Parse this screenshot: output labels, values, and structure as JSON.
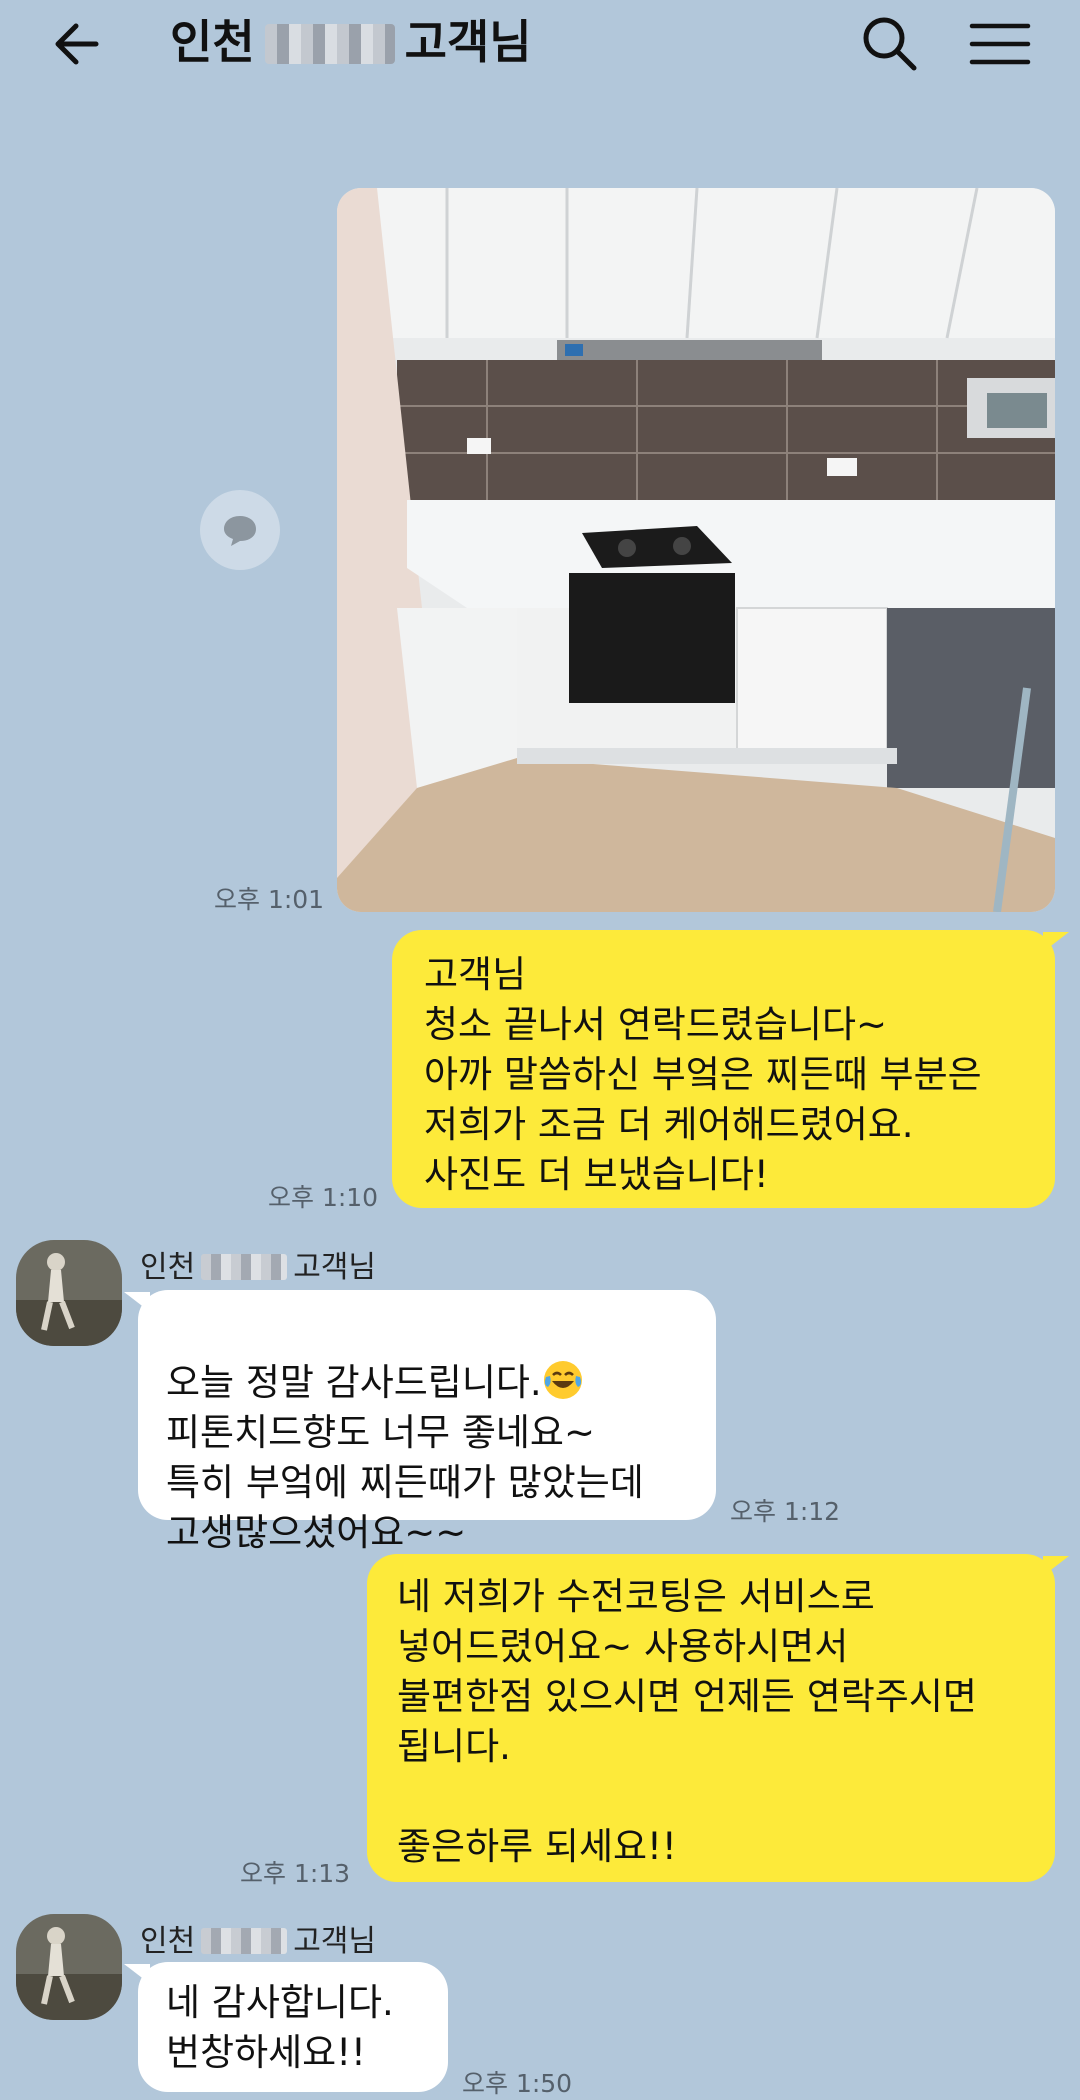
{
  "header": {
    "title_prefix": "인천",
    "title_suffix": "고객님",
    "icons": {
      "back": "arrow-left-icon",
      "search": "search-icon",
      "menu": "hamburger-menu-icon"
    }
  },
  "colors": {
    "background": "#b2c7da",
    "outgoing_bubble": "#fdea3a",
    "incoming_bubble": "#ffffff",
    "timestamp": "#55606b"
  },
  "messages": [
    {
      "direction": "out",
      "type": "photo",
      "alt": "kitchen photo",
      "time": "오후 1:01"
    },
    {
      "direction": "out",
      "type": "text",
      "text": "고객님\n청소 끝나서 연락드렸습니다~\n아까 말씀하신 부엌은 찌든때 부분은\n저희가 조금 더 케어해드렸어요.\n사진도 더 보냈습니다!",
      "time": "오후 1:10"
    },
    {
      "direction": "in",
      "type": "text",
      "sender_prefix": "인천",
      "sender_suffix": "고객님",
      "line1": "오늘 정말 감사드립니다.",
      "emoji": "laughing-tears-emoji",
      "rest": "피톤치드향도 너무 좋네요~\n특히 부엌에 찌든때가 많았는데\n고생많으셨어요~~",
      "time": "오후 1:12"
    },
    {
      "direction": "out",
      "type": "text",
      "text": "네 저희가 수전코팅은 서비스로\n넣어드렸어요~ 사용하시면서\n불편한점 있으시면 언제든 연락주시면\n됩니다.\n\n좋은하루 되세요!!",
      "time": "오후 1:13"
    },
    {
      "direction": "in",
      "type": "text",
      "sender_prefix": "인천",
      "sender_suffix": "고객님",
      "text": "네 감사합니다.\n번창하세요!!",
      "time": "오후 1:50"
    }
  ]
}
